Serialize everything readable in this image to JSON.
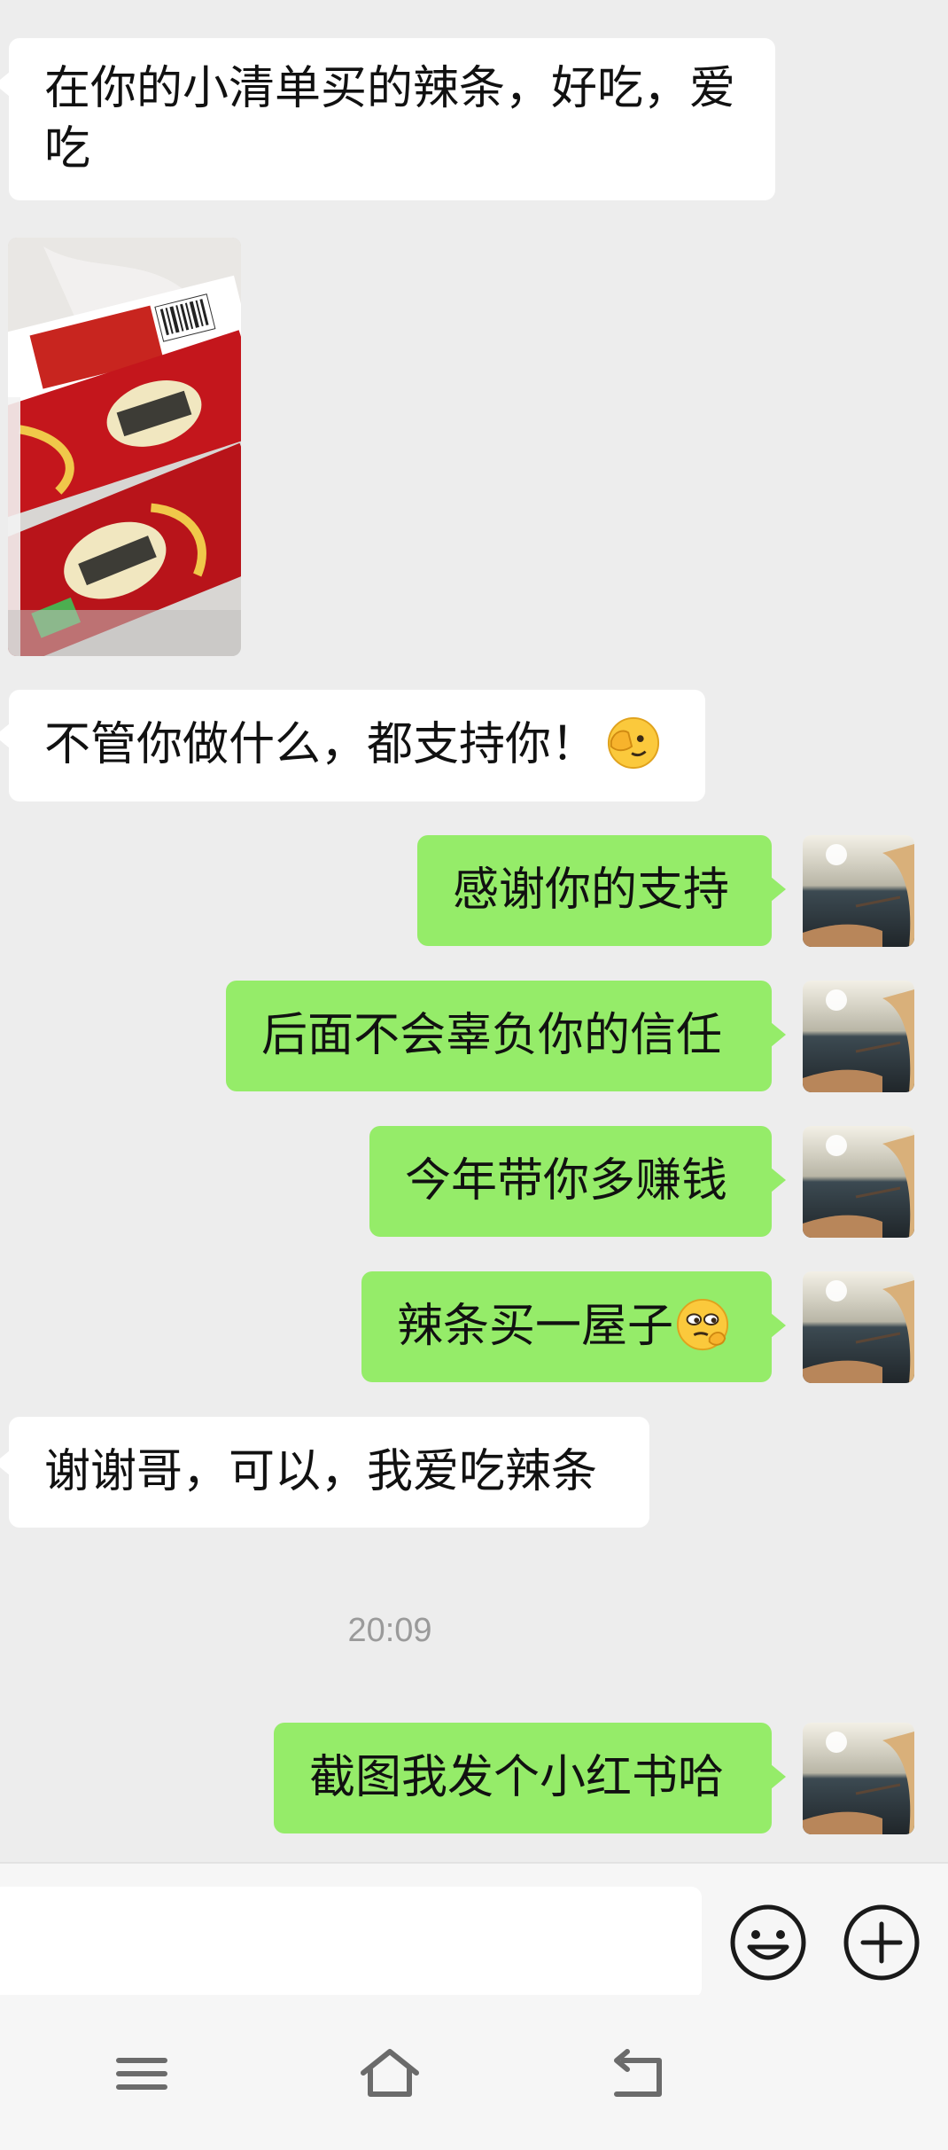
{
  "messages": [
    {
      "side": "in",
      "text": "在你的小清单买的辣条，好吃，爱吃"
    },
    {
      "side": "in",
      "type": "image",
      "image": "spicy-strip-snack-photo"
    },
    {
      "side": "in",
      "text": "不管你做什么，都支持你！",
      "emoji": "face-peeking-emoji"
    },
    {
      "side": "out",
      "text": "感谢你的支持"
    },
    {
      "side": "out",
      "text": "后面不会辜负你的信任"
    },
    {
      "side": "out",
      "text": "今年带你多赚钱"
    },
    {
      "side": "out",
      "text": "辣条买一屋子",
      "emoji": "smirk-emoji"
    },
    {
      "side": "in",
      "text": "谢谢哥，可以，我爱吃辣条"
    },
    {
      "side": "out",
      "text": "截图我发个小红书哈"
    }
  ],
  "timestamp": "20:09",
  "input": {
    "emoji_button": "smiley-face-icon",
    "more_button": "plus-circle-icon"
  },
  "nav": {
    "menu": "menu-icon",
    "home": "home-icon",
    "back": "back-icon"
  },
  "colors": {
    "chat_background": "#ededed",
    "incoming_bubble": "#ffffff",
    "outgoing_bubble": "#95ec69",
    "timestamp": "#9a9a9a"
  }
}
